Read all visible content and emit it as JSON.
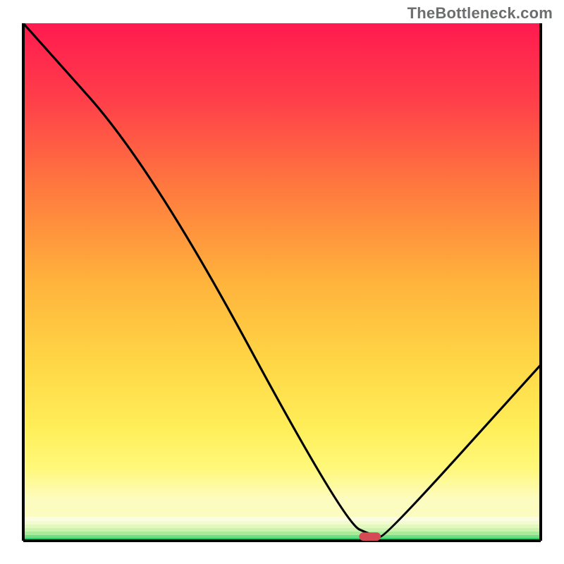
{
  "watermark": "TheBottleneck.com",
  "chart_data": {
    "type": "line",
    "title": "",
    "xlabel": "",
    "ylabel": "",
    "xlim": [
      0,
      100
    ],
    "ylim": [
      0,
      100
    ],
    "x": [
      0,
      25,
      62,
      68,
      70,
      100
    ],
    "values": [
      100,
      72,
      3.5,
      0.8,
      0.8,
      34
    ],
    "background_gradient": {
      "stops": [
        {
          "pos": 0.0,
          "color": "#ff1a4f"
        },
        {
          "pos": 0.5,
          "color": "#ffc93b"
        },
        {
          "pos": 0.78,
          "color": "#ffef5c"
        },
        {
          "pos": 0.9,
          "color": "#f9fcb4"
        },
        {
          "pos": 0.97,
          "color": "#b6f2a6"
        },
        {
          "pos": 1.0,
          "color": "#14d36f"
        }
      ]
    },
    "band_stops": [
      {
        "pos": 0.953,
        "color": "#fdfde0"
      },
      {
        "pos": 0.96,
        "color": "#f1fbcf"
      },
      {
        "pos": 0.967,
        "color": "#e2f8be"
      },
      {
        "pos": 0.974,
        "color": "#ccf3ae"
      },
      {
        "pos": 0.981,
        "color": "#a9ea9b"
      },
      {
        "pos": 0.988,
        "color": "#6fdf84"
      }
    ],
    "marker": {
      "x": 67,
      "y": 0.8,
      "w": 4.2,
      "h": 1.6
    },
    "legend": null,
    "annotations": []
  }
}
